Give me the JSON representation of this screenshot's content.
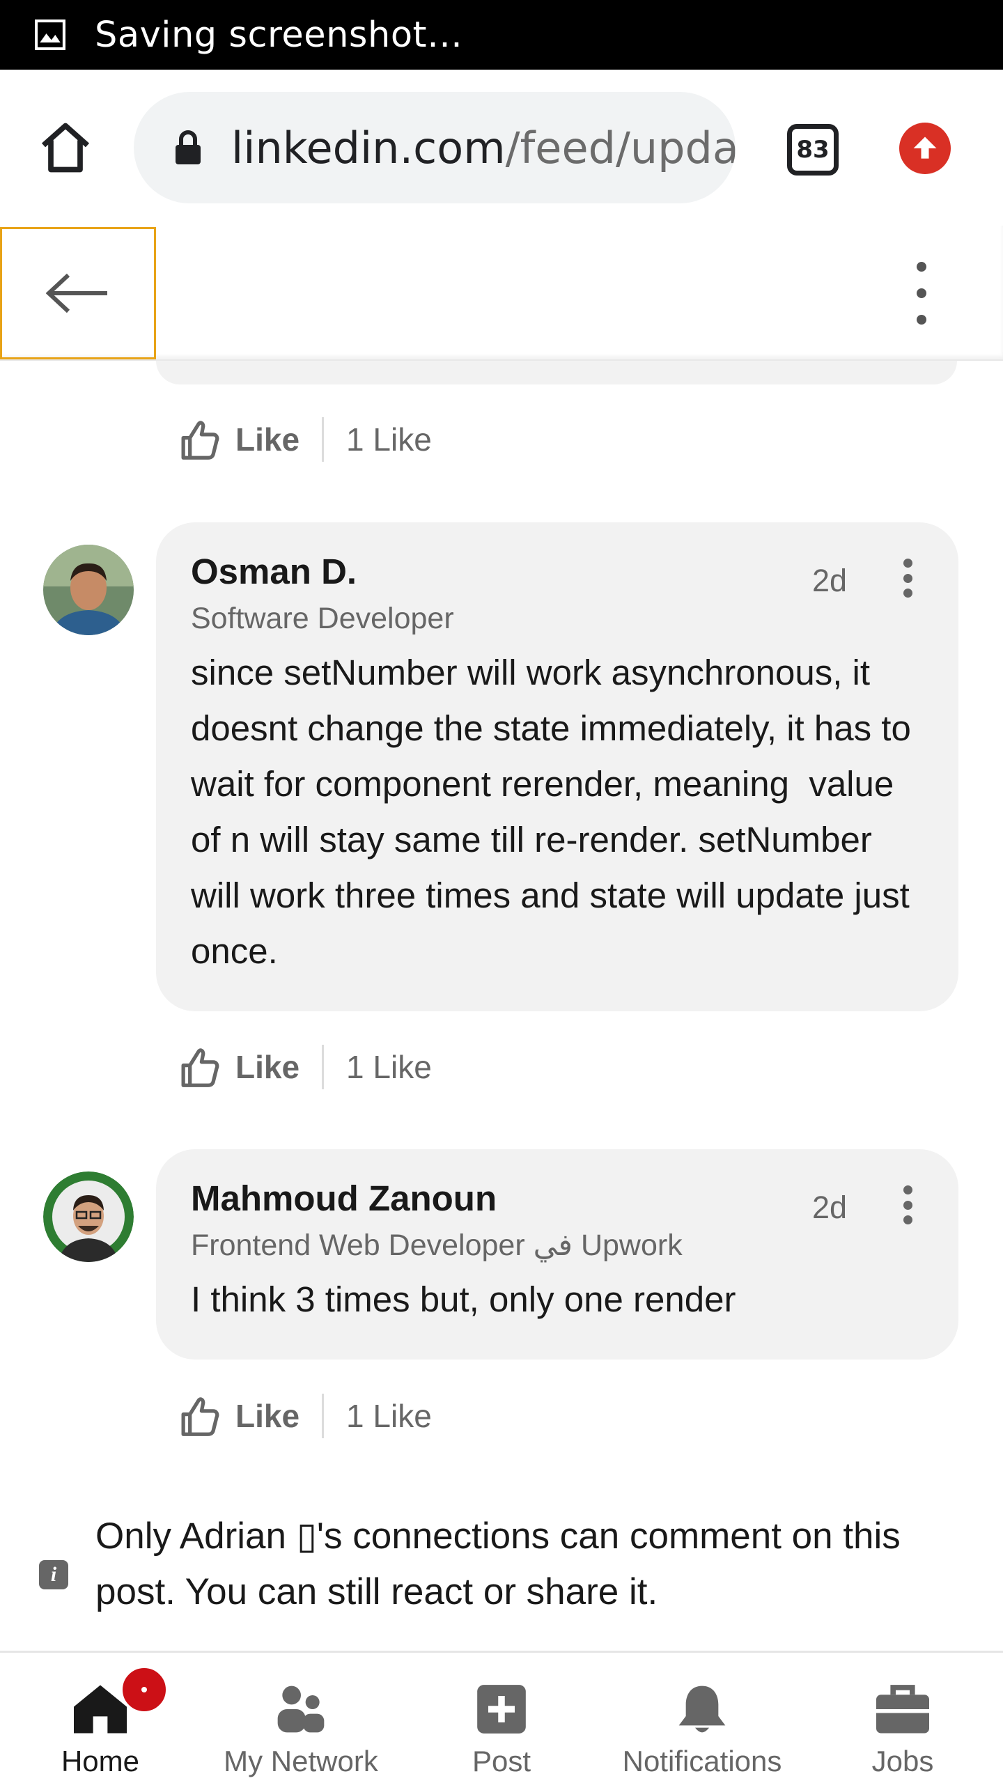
{
  "status_bar": {
    "text": "Saving screenshot…",
    "icon": "image-icon"
  },
  "browser": {
    "url_host": "linkedin.com",
    "url_path": "/feed/update/urn:li:activity",
    "tab_count": "83",
    "icons": {
      "home": "home-icon",
      "lock": "lock-icon",
      "update": "update-arrow-icon"
    }
  },
  "header": {
    "back_icon": "back-arrow-icon",
    "more_icon": "more-vertical-icon"
  },
  "comments": [
    {
      "like_label": "Like",
      "like_count": "1 Like"
    },
    {
      "name": "Osman D.",
      "headline": "Software Developer",
      "time": "2d",
      "text": "since setNumber will work asynchronous, it doesnt change the state immediately, it has to wait for component rerender, meaning  value of n will stay same till re-render. setNumber will work three times and state will update just once.",
      "like_label": "Like",
      "like_count": "1 Like"
    },
    {
      "name": "Mahmoud Zanoun",
      "headline": "Frontend Web Developer في Upwork",
      "time": "2d",
      "text": "I think 3 times but, only one render",
      "like_label": "Like",
      "like_count": "1 Like"
    }
  ],
  "notice": {
    "text": "Only Adrian ▯'s connections can comment on this post. You can still react or share it."
  },
  "nav": [
    {
      "label": "Home",
      "icon": "home-filled-icon",
      "active": true
    },
    {
      "label": "My Network",
      "icon": "people-icon"
    },
    {
      "label": "Post",
      "icon": "plus-square-icon"
    },
    {
      "label": "Notifications",
      "icon": "bell-icon"
    },
    {
      "label": "Jobs",
      "icon": "briefcase-icon"
    }
  ],
  "colors": {
    "accent_red": "#cc1016",
    "bubble": "#f2f2f2",
    "text_secondary": "#666666",
    "focus_outline": "#e8a317"
  }
}
